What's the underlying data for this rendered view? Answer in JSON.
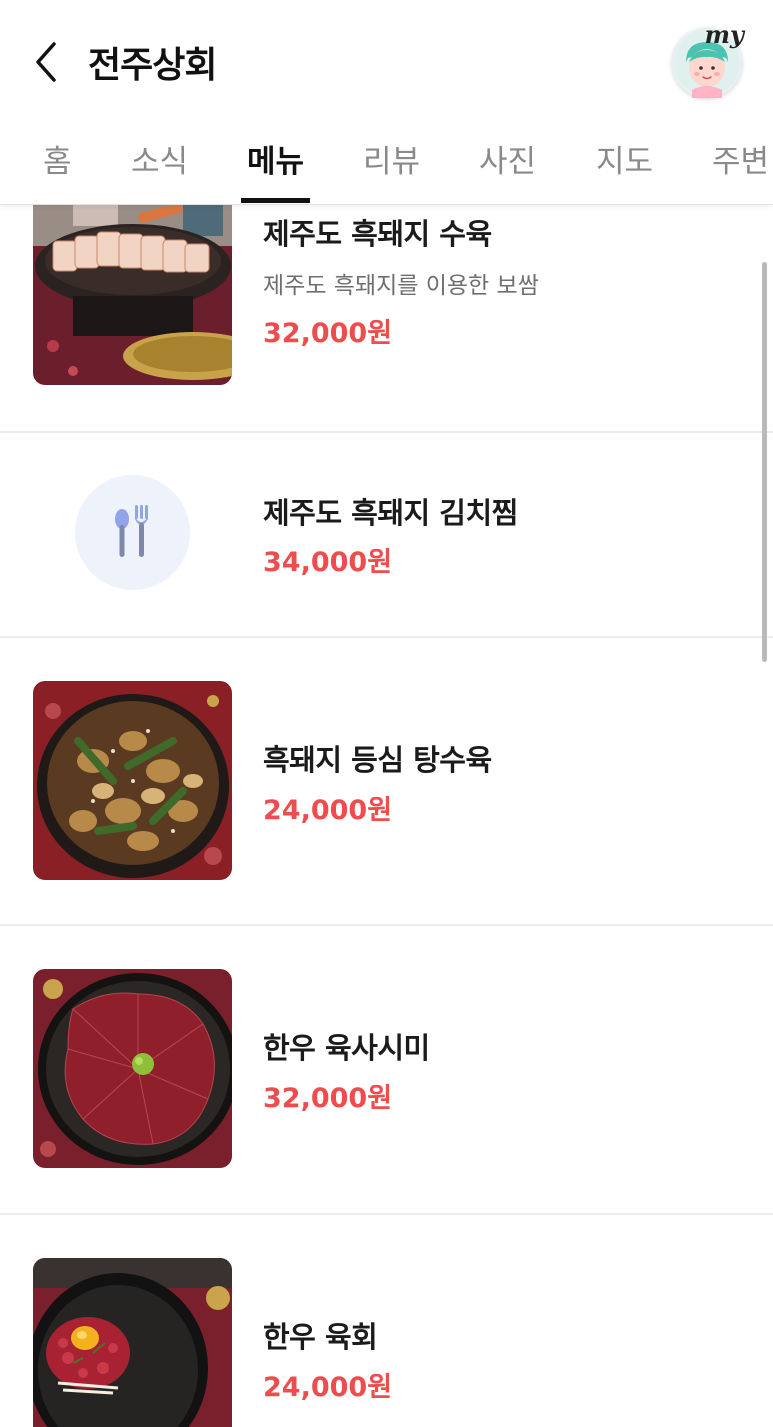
{
  "header": {
    "title": "전주상회",
    "my_label": "my"
  },
  "tabs": [
    {
      "label": "홈",
      "active": false
    },
    {
      "label": "소식",
      "active": false
    },
    {
      "label": "메뉴",
      "active": true
    },
    {
      "label": "리뷰",
      "active": false
    },
    {
      "label": "사진",
      "active": false
    },
    {
      "label": "지도",
      "active": false
    },
    {
      "label": "주변",
      "active": false
    }
  ],
  "menu": {
    "items": [
      {
        "name": "제주도 흑돼지 수육",
        "description": "제주도 흑돼지를 이용한 보쌈",
        "price": "32,000원",
        "photo": "suyuk-photo"
      },
      {
        "name": "제주도 흑돼지 김치찜",
        "price": "34,000원",
        "photo": "utensils-icon"
      },
      {
        "name": "흑돼지 등심 탕수육",
        "price": "24,000원",
        "photo": "tangsuyuk-photo"
      },
      {
        "name": "한우 육사시미",
        "price": "32,000원",
        "photo": "yuksashimi-photo"
      },
      {
        "name": "한우 육회",
        "price": "24,000원",
        "photo": "yukhoe-photo"
      }
    ]
  },
  "colors": {
    "price": "#ee4d4d",
    "active_tab": "#111111",
    "inactive_tab": "#8a8a8a"
  }
}
